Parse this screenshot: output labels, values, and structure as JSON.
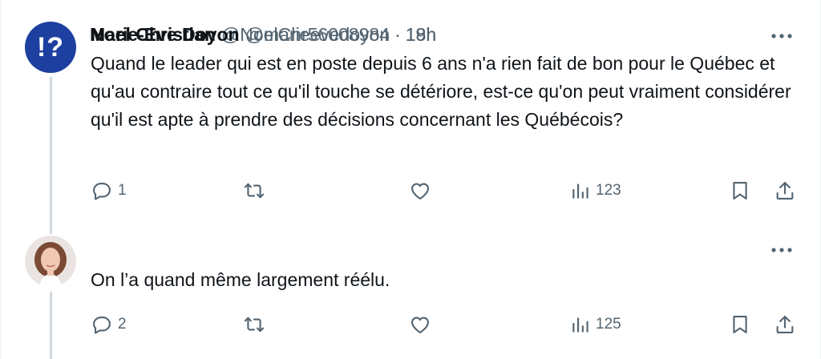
{
  "tweets": [
    {
      "author": {
        "display_name": "Noel Christian",
        "handle": "@NoelChr56008984",
        "avatar_text": "!?",
        "avatar_color": "#1d3fa0"
      },
      "separator": "·",
      "time": "19h",
      "text": "Quand le leader qui est en poste depuis 6 ans n'a rien fait de bon pour le Québec et qu'au contraire tout ce qu'il touche se détériore, est-ce qu'on peut vraiment considérer qu'il est apte à prendre des décisions concernant les Québécois?",
      "replies": "1",
      "views": "123"
    },
    {
      "author": {
        "display_name": "Marie-Eve Doyon",
        "handle": "@marieevedoyon"
      },
      "separator": "·",
      "time": "18h",
      "text": "On l’a quand même largement réélu.",
      "replies": "2",
      "views": "125"
    }
  ],
  "colors": {
    "text_primary": "#0f1419",
    "text_secondary": "#536471",
    "thread_line": "#cfd9de"
  },
  "icons": [
    "reply-icon",
    "retweet-icon",
    "like-icon",
    "views-icon",
    "bookmark-icon",
    "share-icon",
    "more-icon"
  ]
}
